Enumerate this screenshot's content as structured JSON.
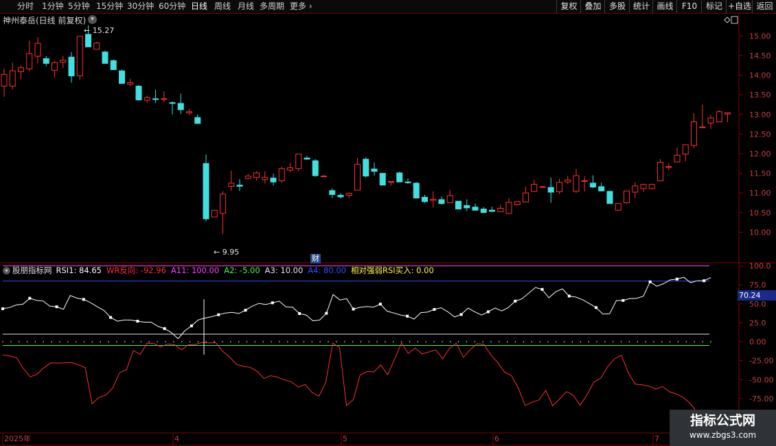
{
  "toolbar": {
    "periods": [
      "分时",
      "1分钟",
      "5分钟",
      "15分钟",
      "30分钟",
      "60分钟",
      "日线",
      "周线",
      "月线",
      "多周期",
      "更多"
    ],
    "active_period": "日线",
    "right_buttons": [
      "复权",
      "叠加",
      "多股",
      "统计",
      "画线",
      "F10",
      "标记",
      "+自选",
      "返回"
    ]
  },
  "chart_title": "神州泰岳(日线 前复权)",
  "indicator_line": {
    "name": "股朋指标网",
    "items": [
      {
        "text": "RSI1: 84.65",
        "color": "#ffffff"
      },
      {
        "text": "WR反向: -92.96",
        "color": "#ff3030"
      },
      {
        "text": "A11: 100.00",
        "color": "#ff40ff"
      },
      {
        "text": "A2: -5.00",
        "color": "#40ff40"
      },
      {
        "text": "A3: 10.00",
        "color": "#e8e8e8"
      },
      {
        "text": "A4: 80.00",
        "color": "#3050ff"
      },
      {
        "text": "相对强弱RSI买入: 0.00",
        "color": "#ffff40"
      }
    ]
  },
  "date_axis": {
    "labels": [
      "2025年",
      "4",
      "5",
      "6",
      "7"
    ]
  },
  "watermark": {
    "title": "指标公式网",
    "url": "www.zbgs3.com"
  },
  "markers": {
    "fin_label": "财",
    "high_label": "15.27",
    "low_label": "9.95"
  },
  "current_value_badge": "70.24",
  "chart_data": [
    {
      "type": "candlestick",
      "title": "神州泰岳(日线 前复权)",
      "price_ticks": [
        "15.00",
        "14.50",
        "14.00",
        "13.50",
        "13.00",
        "12.50",
        "12.00",
        "11.50",
        "11.00",
        "10.50",
        "10.00"
      ],
      "ylim": [
        9.85,
        15.25
      ],
      "colors": {
        "up": "#ff3030",
        "down": "#40e0e0"
      },
      "ohlc": [
        [
          13.72,
          14.17,
          13.45,
          14.02
        ],
        [
          13.72,
          14.32,
          13.64,
          14.11
        ],
        [
          14.09,
          14.25,
          13.9,
          14.19
        ],
        [
          14.16,
          14.88,
          14.1,
          14.55
        ],
        [
          14.48,
          14.97,
          14.3,
          14.81
        ],
        [
          14.42,
          14.49,
          14.23,
          14.3
        ],
        [
          14.12,
          14.36,
          13.94,
          14.32
        ],
        [
          14.33,
          14.49,
          14.18,
          14.38
        ],
        [
          14.46,
          14.59,
          13.81,
          13.98
        ],
        [
          13.98,
          14.92,
          13.88,
          14.99
        ],
        [
          15.04,
          15.27,
          14.82,
          14.72
        ],
        [
          14.66,
          14.85,
          14.68,
          14.82
        ],
        [
          14.59,
          14.62,
          14.29,
          14.3
        ],
        [
          14.37,
          14.4,
          14.13,
          14.14
        ],
        [
          14.11,
          14.14,
          13.86,
          13.79
        ],
        [
          13.77,
          13.91,
          13.72,
          13.81
        ],
        [
          13.72,
          13.75,
          13.35,
          13.37
        ],
        [
          13.36,
          13.48,
          13.3,
          13.43
        ],
        [
          13.4,
          13.63,
          13.29,
          13.38
        ],
        [
          13.38,
          13.59,
          13.31,
          13.4
        ],
        [
          13.3,
          13.33,
          13.0,
          13.28
        ],
        [
          13.28,
          13.53,
          13.01,
          13.12
        ],
        [
          13.04,
          13.14,
          12.99,
          13.07
        ],
        [
          12.92,
          13.0,
          12.81,
          12.77
        ],
        [
          11.75,
          11.98,
          10.28,
          10.34
        ],
        [
          10.39,
          10.43,
          10.39,
          10.56
        ],
        [
          10.48,
          11.05,
          9.95,
          10.97
        ],
        [
          11.17,
          11.57,
          11.05,
          11.25
        ],
        [
          11.2,
          11.35,
          11.05,
          11.17
        ],
        [
          11.37,
          11.48,
          11.35,
          11.43
        ],
        [
          11.39,
          11.55,
          11.32,
          11.51
        ],
        [
          11.34,
          11.55,
          11.24,
          11.4
        ],
        [
          11.38,
          11.49,
          11.19,
          11.28
        ],
        [
          11.31,
          11.67,
          11.26,
          11.62
        ],
        [
          11.58,
          11.77,
          11.53,
          11.64
        ],
        [
          11.62,
          11.95,
          11.55,
          11.99
        ],
        [
          11.89,
          11.94,
          11.9,
          11.86
        ],
        [
          11.82,
          11.86,
          11.41,
          11.44
        ],
        [
          11.43,
          11.46,
          11.44,
          11.43
        ],
        [
          11.06,
          11.12,
          10.87,
          10.96
        ],
        [
          10.94,
          11.0,
          10.86,
          10.9
        ],
        [
          10.94,
          11.01,
          10.87,
          10.99
        ],
        [
          11.07,
          11.89,
          11.07,
          11.73
        ],
        [
          11.86,
          11.9,
          11.39,
          11.43
        ],
        [
          11.61,
          11.77,
          11.44,
          11.55
        ],
        [
          11.5,
          11.51,
          11.19,
          11.2
        ],
        [
          11.27,
          11.29,
          11.19,
          11.29
        ],
        [
          11.51,
          11.54,
          11.32,
          11.28
        ],
        [
          11.28,
          11.37,
          11.23,
          11.26
        ],
        [
          11.25,
          11.27,
          10.86,
          10.87
        ],
        [
          10.89,
          10.95,
          10.75,
          10.78
        ],
        [
          10.81,
          11.04,
          10.63,
          10.84
        ],
        [
          10.83,
          10.91,
          10.7,
          10.73
        ],
        [
          10.75,
          11.08,
          10.75,
          10.93
        ],
        [
          10.79,
          10.79,
          10.6,
          10.59
        ],
        [
          10.68,
          10.84,
          10.54,
          10.62
        ],
        [
          10.64,
          10.73,
          10.57,
          10.56
        ],
        [
          10.59,
          10.64,
          10.5,
          10.5
        ],
        [
          10.56,
          10.65,
          10.52,
          10.53
        ],
        [
          10.52,
          10.7,
          10.52,
          10.61
        ],
        [
          10.48,
          10.87,
          10.46,
          10.76
        ],
        [
          10.7,
          10.79,
          10.69,
          10.78
        ],
        [
          10.77,
          11.16,
          10.76,
          11.0
        ],
        [
          11.04,
          11.34,
          11.04,
          11.22
        ],
        [
          11.16,
          11.18,
          11.14,
          11.16
        ],
        [
          11.14,
          11.39,
          10.75,
          11.02
        ],
        [
          11.03,
          11.36,
          10.97,
          11.27
        ],
        [
          11.28,
          11.44,
          11.23,
          11.33
        ],
        [
          11.04,
          11.61,
          11.0,
          11.44
        ],
        [
          11.3,
          11.42,
          11.04,
          11.31
        ],
        [
          11.25,
          11.45,
          11.12,
          11.15
        ],
        [
          11.16,
          11.26,
          11.1,
          11.05
        ],
        [
          11.04,
          11.06,
          10.93,
          10.73
        ],
        [
          10.56,
          10.59,
          10.55,
          10.73
        ],
        [
          10.75,
          11.02,
          10.73,
          11.05
        ],
        [
          11.02,
          11.27,
          10.87,
          11.18
        ],
        [
          11.11,
          11.23,
          11.02,
          11.22
        ],
        [
          11.11,
          11.13,
          11.09,
          11.22
        ],
        [
          11.31,
          11.86,
          11.3,
          11.78
        ],
        [
          11.66,
          11.76,
          11.59,
          11.67
        ],
        [
          11.79,
          12.16,
          11.79,
          11.96
        ],
        [
          11.99,
          12.09,
          11.81,
          12.23
        ],
        [
          12.21,
          13.03,
          12.14,
          12.81
        ],
        [
          12.68,
          13.25,
          12.66,
          12.68
        ],
        [
          12.78,
          12.99,
          12.63,
          12.91
        ],
        [
          12.81,
          13.11,
          12.8,
          13.07
        ],
        [
          13.01,
          13.05,
          12.8,
          13.04
        ]
      ]
    },
    {
      "type": "line",
      "title": "股朋指标网",
      "yticks": [
        "100.0",
        "75.0",
        "50.0",
        "25.0",
        "0.00",
        "-25.00",
        "-50.00",
        "-75.00"
      ],
      "ylim": [
        -78.72,
        105.0
      ],
      "reference_lines": [
        {
          "name": "A11",
          "value": 100,
          "color": "#ff40ff"
        },
        {
          "name": "A4",
          "value": 80,
          "color": "#3050ff"
        },
        {
          "name": "A3",
          "value": 10,
          "color": "#e8e8e8"
        },
        {
          "name": "A2",
          "value": -5,
          "color": "#40ff40"
        }
      ],
      "series": [
        {
          "name": "RSI1",
          "color": "#ffffff",
          "values": [
            43.5,
            45.1,
            48.4,
            49.5,
            57.3,
            54.6,
            53.6,
            47.0,
            46.1,
            42.8,
            61.0,
            57.5,
            55.8,
            51.7,
            46.2,
            41.3,
            32.0,
            27.1,
            28.6,
            28.6,
            27.1,
            25.8,
            25.8,
            20.4,
            17.3,
            12.0,
            4.0,
            14.5,
            20.9,
            28.8,
            31.2,
            33.0,
            35.6,
            37.8,
            38.7,
            37.2,
            41.5,
            46.9,
            50.6,
            49.0,
            51.3,
            53.5,
            46.0,
            45.5,
            37.1,
            35.2,
            27.5,
            28.6,
            37.5,
            62.3,
            55.0,
            56.7,
            43.0,
            45.4,
            46.3,
            45.6,
            49.6,
            40.3,
            37.8,
            35.2,
            33.7,
            29.9,
            38.4,
            39.0,
            42.6,
            44.8,
            39.5,
            32.7,
            35.9,
            44.3,
            39.5,
            35.2,
            39.5,
            44.4,
            40.5,
            45.2,
            53.5,
            56.6,
            64.1,
            71.5,
            69.0,
            58.0,
            65.9,
            69.7,
            60.2,
            58.8,
            55.4,
            50.3,
            45.0,
            36.5,
            36.8,
            54.2,
            54.4,
            56.9,
            57.1,
            60.0,
            79.0,
            73.1,
            76.6,
            81.5,
            82.6,
            85.0,
            77.9,
            80.4,
            80.4,
            84.6
          ]
        },
        {
          "name": "WR反向",
          "color": "#ff3030",
          "values": [
            -17.4,
            -18.8,
            -21.0,
            -35.4,
            -46.3,
            -42.9,
            -34.1,
            -28.0,
            -28.1,
            -27.8,
            -27.5,
            -30.5,
            -34.3,
            -81.7,
            -73.5,
            -70.4,
            -60.9,
            -40.9,
            -36.7,
            -11.6,
            -16.7,
            -2.0,
            -2.4,
            -6.8,
            -2.9,
            -4.0,
            -10.7,
            -4.1,
            -3.8,
            -0.9,
            -1.7,
            -1.3,
            -12.7,
            -20.2,
            -29.8,
            -32.6,
            -33.8,
            -39.1,
            -48.6,
            -44.8,
            -46.8,
            -50.4,
            -53.1,
            -59.7,
            -56.4,
            -67.0,
            -71.9,
            -53.1,
            -1.9,
            -7.8,
            -84.4,
            -76.5,
            -43.8,
            -39.3,
            -39.9,
            -30.6,
            -43.4,
            -23.2,
            -1.7,
            -15.6,
            -8.3,
            -16.1,
            -13.5,
            -10.8,
            -22.5,
            -8.8,
            -1.9,
            -20.6,
            -10.6,
            -2.6,
            -3.6,
            -17.5,
            -27.2,
            -40.1,
            -44.6,
            -61.0,
            -84.2,
            -79.8,
            -76.9,
            -64.2,
            -84.6,
            -75.7,
            -65.8,
            -70.6,
            -83.9,
            -69.8,
            -53.3,
            -48.2,
            -32.9,
            -22.7,
            -17.8,
            -40.9,
            -55.9,
            -56.9,
            -58.5,
            -62.4,
            -59.2,
            -66.1,
            -68.9,
            -73.5,
            -81.4,
            -92.9,
            -92.9,
            -92.9
          ]
        }
      ]
    }
  ]
}
